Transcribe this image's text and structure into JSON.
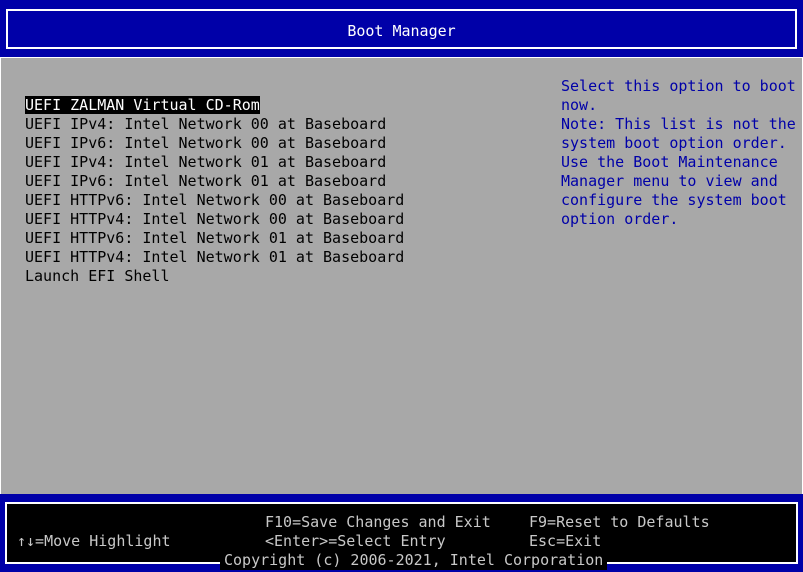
{
  "header": {
    "title": "Boot Manager"
  },
  "boot_entries": [
    {
      "label": "UEFI ZALMAN Virtual CD-Rom",
      "selected": true
    },
    {
      "label": "UEFI IPv4: Intel Network 00 at Baseboard",
      "selected": false
    },
    {
      "label": "UEFI IPv6: Intel Network 00 at Baseboard",
      "selected": false
    },
    {
      "label": "UEFI IPv4: Intel Network 01 at Baseboard",
      "selected": false
    },
    {
      "label": "UEFI IPv6: Intel Network 01 at Baseboard",
      "selected": false
    },
    {
      "label": "UEFI HTTPv6: Intel Network 00 at Baseboard",
      "selected": false
    },
    {
      "label": "UEFI HTTPv4: Intel Network 00 at Baseboard",
      "selected": false
    },
    {
      "label": "UEFI HTTPv6: Intel Network 01 at Baseboard",
      "selected": false
    },
    {
      "label": "UEFI HTTPv4: Intel Network 01 at Baseboard",
      "selected": false
    },
    {
      "label": "Launch EFI Shell",
      "selected": false
    }
  ],
  "help": {
    "lines": [
      "Select this option to boot",
      "now.",
      "Note: This list is not the",
      "system boot option order.",
      "Use the Boot Maintenance",
      "Manager menu to view and",
      "configure the system boot",
      "option order."
    ]
  },
  "footer": {
    "save_exit": "F10=Save Changes and Exit",
    "reset_defaults": "F9=Reset to Defaults",
    "move_highlight": "↑↓=Move Highlight",
    "select_entry": "<Enter>=Select Entry",
    "esc_exit": "Esc=Exit",
    "copyright": "Copyright (c) 2006-2021, Intel Corporation"
  },
  "colors": {
    "frame_blue": "#0000a8",
    "panel_gray": "#a8a8a8",
    "help_text": "#0000a8",
    "highlight_bg": "#000000",
    "highlight_fg": "#ffffff"
  }
}
